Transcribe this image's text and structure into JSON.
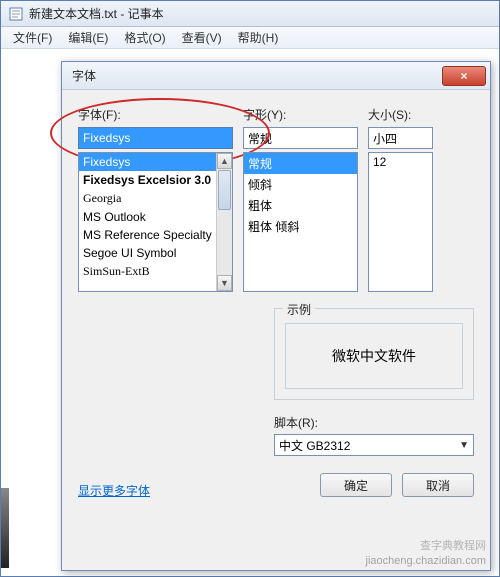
{
  "window": {
    "title": "新建文本文档.txt - 记事本"
  },
  "menu": {
    "file": "文件(F)",
    "edit": "编辑(E)",
    "format": "格式(O)",
    "view": "查看(V)",
    "help": "帮助(H)"
  },
  "dialog": {
    "title": "字体",
    "close_icon": "×",
    "font": {
      "label": "字体(F):",
      "value": "Fixedsys",
      "items": [
        "Fixedsys",
        "Fixedsys Excelsior 3.0",
        "Georgia",
        "MS Outlook",
        "MS Reference Specialty",
        "Segoe UI Symbol",
        "SimSun-ExtB"
      ]
    },
    "style": {
      "label": "字形(Y):",
      "value": "常规",
      "items": [
        "常规",
        "倾斜",
        "粗体",
        "粗体 倾斜"
      ]
    },
    "size": {
      "label": "大小(S):",
      "value": "小四",
      "items": [
        "12"
      ]
    },
    "sample": {
      "label": "示例",
      "text": "微软中文软件"
    },
    "script": {
      "label": "脚本(R):",
      "value": "中文 GB2312"
    },
    "link": "显示更多字体",
    "ok": "确定",
    "cancel": "取消"
  },
  "watermark": {
    "line1": "查字典教程网",
    "line2": "jiaocheng.chazidian.com"
  }
}
